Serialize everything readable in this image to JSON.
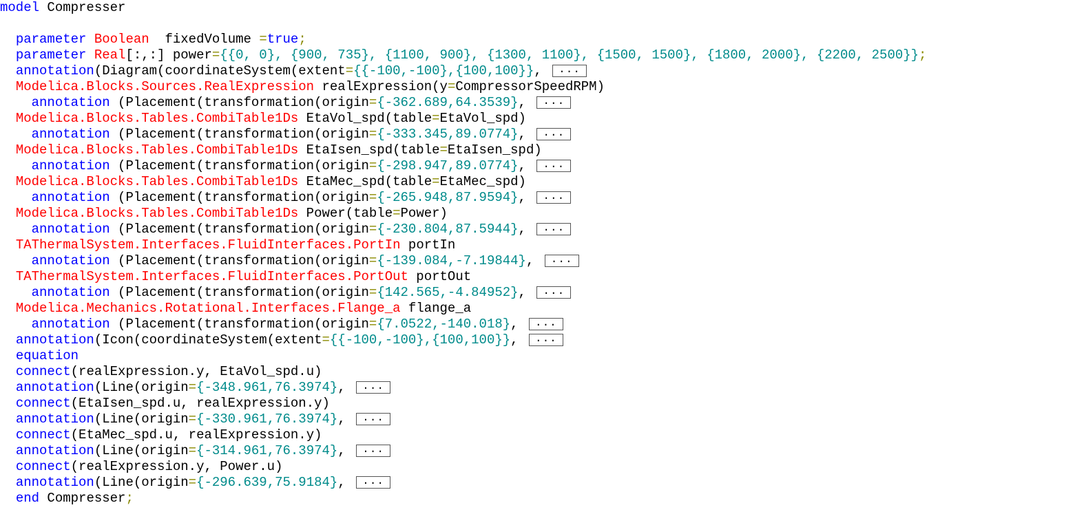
{
  "colors": {
    "keyword": "#0000ff",
    "type": "#ff0000",
    "text": "#000000",
    "number": "#008b8b",
    "operator": "#8b8b00",
    "background": "#ffffff"
  },
  "collapse_label": "...",
  "lines": [
    [
      [
        "kw",
        "model"
      ],
      [
        "txt",
        " Compresser"
      ]
    ],
    [],
    [
      [
        "txt",
        "  "
      ],
      [
        "kw",
        "parameter"
      ],
      [
        "txt",
        " "
      ],
      [
        "type",
        "Boolean"
      ],
      [
        "txt",
        "  fixedVolume "
      ],
      [
        "op",
        "="
      ],
      [
        "kw",
        "true"
      ],
      [
        "op",
        ";"
      ]
    ],
    [
      [
        "txt",
        "  "
      ],
      [
        "kw",
        "parameter"
      ],
      [
        "txt",
        " "
      ],
      [
        "type",
        "Real"
      ],
      [
        "txt",
        "[:,:] power"
      ],
      [
        "op",
        "="
      ],
      [
        "num",
        "{{0, 0}, {900, 735}, {1100, 900}, {1300, 1100}, {1500, 1500}, {1800, 2000}, {2200, 2500}}"
      ],
      [
        "op",
        ";"
      ]
    ],
    [
      [
        "txt",
        "  "
      ],
      [
        "kw",
        "annotation"
      ],
      [
        "txt",
        "(Diagram(coordinateSystem(extent"
      ],
      [
        "op",
        "="
      ],
      [
        "num",
        "{{-100,-100},{100,100}}"
      ],
      [
        "txt",
        ", "
      ],
      [
        "dots",
        "..."
      ]
    ],
    [
      [
        "txt",
        "  "
      ],
      [
        "type",
        "Modelica.Blocks.Sources.RealExpression"
      ],
      [
        "txt",
        " realExpression(y"
      ],
      [
        "op",
        "="
      ],
      [
        "txt",
        "CompressorSpeedRPM)"
      ]
    ],
    [
      [
        "txt",
        "    "
      ],
      [
        "kw",
        "annotation"
      ],
      [
        "txt",
        " (Placement(transformation(origin"
      ],
      [
        "op",
        "="
      ],
      [
        "num",
        "{-362.689,64.3539}"
      ],
      [
        "txt",
        ", "
      ],
      [
        "dots",
        "..."
      ]
    ],
    [
      [
        "txt",
        "  "
      ],
      [
        "type",
        "Modelica.Blocks.Tables.CombiTable1Ds"
      ],
      [
        "txt",
        " EtaVol_spd(table"
      ],
      [
        "op",
        "="
      ],
      [
        "txt",
        "EtaVol_spd)"
      ]
    ],
    [
      [
        "txt",
        "    "
      ],
      [
        "kw",
        "annotation"
      ],
      [
        "txt",
        " (Placement(transformation(origin"
      ],
      [
        "op",
        "="
      ],
      [
        "num",
        "{-333.345,89.0774}"
      ],
      [
        "txt",
        ", "
      ],
      [
        "dots",
        "..."
      ]
    ],
    [
      [
        "txt",
        "  "
      ],
      [
        "type",
        "Modelica.Blocks.Tables.CombiTable1Ds"
      ],
      [
        "txt",
        " EtaIsen_spd(table"
      ],
      [
        "op",
        "="
      ],
      [
        "txt",
        "EtaIsen_spd)"
      ]
    ],
    [
      [
        "txt",
        "    "
      ],
      [
        "kw",
        "annotation"
      ],
      [
        "txt",
        " (Placement(transformation(origin"
      ],
      [
        "op",
        "="
      ],
      [
        "num",
        "{-298.947,89.0774}"
      ],
      [
        "txt",
        ", "
      ],
      [
        "dots",
        "..."
      ]
    ],
    [
      [
        "txt",
        "  "
      ],
      [
        "type",
        "Modelica.Blocks.Tables.CombiTable1Ds"
      ],
      [
        "txt",
        " EtaMec_spd(table"
      ],
      [
        "op",
        "="
      ],
      [
        "txt",
        "EtaMec_spd)"
      ]
    ],
    [
      [
        "txt",
        "    "
      ],
      [
        "kw",
        "annotation"
      ],
      [
        "txt",
        " (Placement(transformation(origin"
      ],
      [
        "op",
        "="
      ],
      [
        "num",
        "{-265.948,87.9594}"
      ],
      [
        "txt",
        ", "
      ],
      [
        "dots",
        "..."
      ]
    ],
    [
      [
        "txt",
        "  "
      ],
      [
        "type",
        "Modelica.Blocks.Tables.CombiTable1Ds"
      ],
      [
        "txt",
        " Power(table"
      ],
      [
        "op",
        "="
      ],
      [
        "txt",
        "Power)"
      ]
    ],
    [
      [
        "txt",
        "    "
      ],
      [
        "kw",
        "annotation"
      ],
      [
        "txt",
        " (Placement(transformation(origin"
      ],
      [
        "op",
        "="
      ],
      [
        "num",
        "{-230.804,87.5944}"
      ],
      [
        "txt",
        ", "
      ],
      [
        "dots",
        "..."
      ]
    ],
    [
      [
        "txt",
        "  "
      ],
      [
        "type",
        "TAThermalSystem.Interfaces.FluidInterfaces.PortIn"
      ],
      [
        "txt",
        " portIn"
      ]
    ],
    [
      [
        "txt",
        "    "
      ],
      [
        "kw",
        "annotation"
      ],
      [
        "txt",
        " (Placement(transformation(origin"
      ],
      [
        "op",
        "="
      ],
      [
        "num",
        "{-139.084,-7.19844}"
      ],
      [
        "txt",
        ", "
      ],
      [
        "dots",
        "..."
      ]
    ],
    [
      [
        "txt",
        "  "
      ],
      [
        "type",
        "TAThermalSystem.Interfaces.FluidInterfaces.PortOut"
      ],
      [
        "txt",
        " portOut"
      ]
    ],
    [
      [
        "txt",
        "    "
      ],
      [
        "kw",
        "annotation"
      ],
      [
        "txt",
        " (Placement(transformation(origin"
      ],
      [
        "op",
        "="
      ],
      [
        "num",
        "{142.565,-4.84952}"
      ],
      [
        "txt",
        ", "
      ],
      [
        "dots",
        "..."
      ]
    ],
    [
      [
        "txt",
        "  "
      ],
      [
        "type",
        "Modelica.Mechanics.Rotational.Interfaces.Flange_a"
      ],
      [
        "txt",
        " flange_a"
      ]
    ],
    [
      [
        "txt",
        "    "
      ],
      [
        "kw",
        "annotation"
      ],
      [
        "txt",
        " (Placement(transformation(origin"
      ],
      [
        "op",
        "="
      ],
      [
        "num",
        "{7.0522,-140.018}"
      ],
      [
        "txt",
        ", "
      ],
      [
        "dots",
        "..."
      ]
    ],
    [
      [
        "txt",
        "  "
      ],
      [
        "kw",
        "annotation"
      ],
      [
        "txt",
        "(Icon(coordinateSystem(extent"
      ],
      [
        "op",
        "="
      ],
      [
        "num",
        "{{-100,-100},{100,100}}"
      ],
      [
        "txt",
        ", "
      ],
      [
        "dots",
        "..."
      ]
    ],
    [
      [
        "txt",
        "  "
      ],
      [
        "kw",
        "equation"
      ]
    ],
    [
      [
        "txt",
        "  "
      ],
      [
        "kw",
        "connect"
      ],
      [
        "txt",
        "(realExpression.y, EtaVol_spd.u)"
      ]
    ],
    [
      [
        "txt",
        "  "
      ],
      [
        "kw",
        "annotation"
      ],
      [
        "txt",
        "(Line(origin"
      ],
      [
        "op",
        "="
      ],
      [
        "num",
        "{-348.961,76.3974}"
      ],
      [
        "txt",
        ", "
      ],
      [
        "dots",
        "..."
      ]
    ],
    [
      [
        "txt",
        "  "
      ],
      [
        "kw",
        "connect"
      ],
      [
        "txt",
        "(EtaIsen_spd.u, realExpression.y)"
      ]
    ],
    [
      [
        "txt",
        "  "
      ],
      [
        "kw",
        "annotation"
      ],
      [
        "txt",
        "(Line(origin"
      ],
      [
        "op",
        "="
      ],
      [
        "num",
        "{-330.961,76.3974}"
      ],
      [
        "txt",
        ", "
      ],
      [
        "dots",
        "..."
      ]
    ],
    [
      [
        "txt",
        "  "
      ],
      [
        "kw",
        "connect"
      ],
      [
        "txt",
        "(EtaMec_spd.u, realExpression.y)"
      ]
    ],
    [
      [
        "txt",
        "  "
      ],
      [
        "kw",
        "annotation"
      ],
      [
        "txt",
        "(Line(origin"
      ],
      [
        "op",
        "="
      ],
      [
        "num",
        "{-314.961,76.3974}"
      ],
      [
        "txt",
        ", "
      ],
      [
        "dots",
        "..."
      ]
    ],
    [
      [
        "txt",
        "  "
      ],
      [
        "kw",
        "connect"
      ],
      [
        "txt",
        "(realExpression.y, Power.u)"
      ]
    ],
    [
      [
        "txt",
        "  "
      ],
      [
        "kw",
        "annotation"
      ],
      [
        "txt",
        "(Line(origin"
      ],
      [
        "op",
        "="
      ],
      [
        "num",
        "{-296.639,75.9184}"
      ],
      [
        "txt",
        ", "
      ],
      [
        "dots",
        "..."
      ]
    ],
    [
      [
        "txt",
        "  "
      ],
      [
        "kw",
        "end"
      ],
      [
        "txt",
        " Compresser"
      ],
      [
        "op",
        ";"
      ]
    ]
  ]
}
